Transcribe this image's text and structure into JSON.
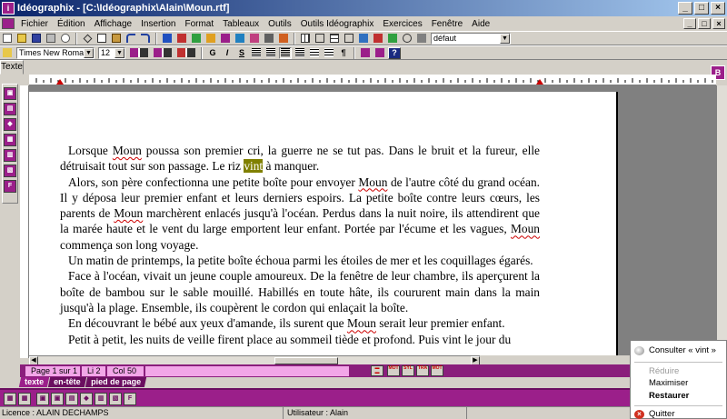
{
  "window": {
    "title": "Idéographix - [C:\\Idéographix\\Alain\\Moun.rtf]",
    "app_icon": "ideographix-logo",
    "minimize": "_",
    "maximize": "□",
    "close": "×"
  },
  "menu": {
    "items": [
      "Fichier",
      "Édition",
      "Affichage",
      "Insertion",
      "Format",
      "Tableaux",
      "Outils",
      "Outils Idéographix",
      "Exercices",
      "Fenêtre",
      "Aide"
    ]
  },
  "toolbar1": {
    "style_combo": "défaut"
  },
  "toolbar2": {
    "font_combo": "Times New Roman",
    "size_combo": "12",
    "bold": "G",
    "italic": "I",
    "strike": "S",
    "pilcrow": "¶",
    "help": "?"
  },
  "tab_texte": "Texte",
  "right_button": "B",
  "document": {
    "paragraphs": [
      [
        {
          "t": "Lorsque "
        },
        {
          "t": "Moun",
          "m": "spell"
        },
        {
          "t": " poussa son premier cri, la guerre ne se tut pas. Dans le bruit et la fureur, elle détruisait tout sur son passage. Le riz "
        },
        {
          "t": "vint",
          "m": "sel"
        },
        {
          "t": " à manquer."
        }
      ],
      [
        {
          "t": "Alors, son père confectionna une petite boîte pour envoyer "
        },
        {
          "t": "Moun",
          "m": "spell"
        },
        {
          "t": " de l'autre côté du grand océan. Il y déposa leur premier enfant et leurs derniers espoirs. La petite boîte contre leurs cœurs, les parents de "
        },
        {
          "t": "Moun",
          "m": "spell"
        },
        {
          "t": " marchèrent enlacés jusqu'à l'océan. Perdus dans la nuit noire, ils attendirent que la marée haute et le vent du large emportent leur enfant. Portée par l'écume et les vagues, "
        },
        {
          "t": "Moun",
          "m": "spell"
        },
        {
          "t": " commença son long voyage."
        }
      ],
      [
        {
          "t": "Un matin de printemps, la petite boîte échoua parmi les étoiles de mer et les coquillages égarés."
        }
      ],
      [
        {
          "t": "Face à l'océan, vivait un jeune couple amoureux. De la fenêtre de leur chambre, ils aperçurent la boîte de bambou sur le sable mouillé. Habillés en toute hâte, ils coururent main dans la main  jusqu'à la plage. Ensemble, ils coupèrent le cordon qui enlaçait la boîte."
        }
      ],
      [
        {
          "t": "En découvrant le bébé aux yeux d'amande, ils surent que "
        },
        {
          "t": "Moun",
          "m": "spell"
        },
        {
          "t": " serait leur premier enfant."
        }
      ],
      [
        {
          "t": "Petit à petit, les nuits de veille firent place au sommeil tiède et profond. Puis vint le jour du"
        }
      ]
    ]
  },
  "status": {
    "page": "Page 1 sur 1",
    "line": "Li 2",
    "col": "Col 50",
    "icon_labels": [
      "MOT",
      "SYL",
      "TRA",
      "MOT"
    ]
  },
  "view_tabs": [
    "texte",
    "en-tête",
    "pied de page"
  ],
  "license": {
    "licence": "Licence : ALAIN DECHAMPS",
    "user": "Utilisateur : Alain"
  },
  "context_menu": {
    "consult": "Consulter « vint »",
    "reduce": "Réduire",
    "maximize": "Maximiser",
    "restore": "Restaurer",
    "quit": "Quitter"
  },
  "colors": {
    "accent_purple": "#9b1f8a",
    "dark_purple": "#8a1e7c",
    "selection": "#808000",
    "spell_underline": "#cc0000"
  }
}
